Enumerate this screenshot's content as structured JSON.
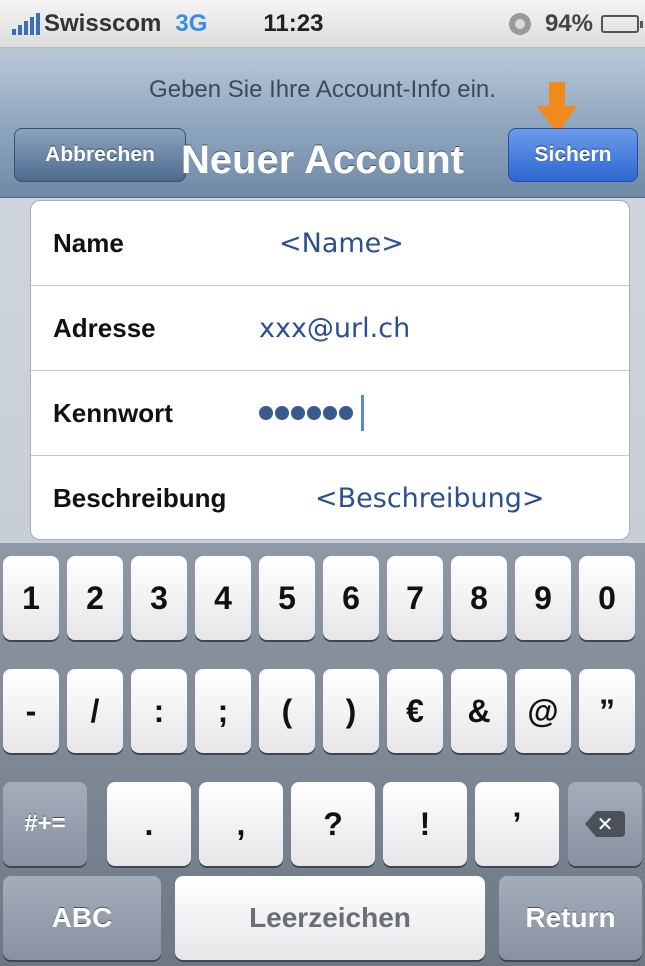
{
  "status_bar": {
    "carrier": "Swisscom",
    "network": "3G",
    "time": "11:23",
    "battery_percent": "94%",
    "battery_level": 0.94,
    "icons": [
      "signal-icon",
      "alarm-icon",
      "battery-icon"
    ]
  },
  "nav": {
    "prompt": "Geben Sie Ihre Account-Info ein.",
    "title": "Neuer Account",
    "cancel_label": "Abbrechen",
    "save_label": "Sichern",
    "annotation_color": "#f08a1c"
  },
  "form": {
    "fields": [
      {
        "label": "Name",
        "value": "<Name>"
      },
      {
        "label": "Adresse",
        "value": "xxx@url.ch"
      },
      {
        "label": "Kennwort",
        "masked_length": 6
      },
      {
        "label": "Beschreibung",
        "value": "<Beschreibung>"
      }
    ],
    "value_color": "#2b4f8f"
  },
  "keyboard": {
    "row1": [
      "1",
      "2",
      "3",
      "4",
      "5",
      "6",
      "7",
      "8",
      "9",
      "0"
    ],
    "row2": [
      "-",
      "/",
      ":",
      ";",
      "(",
      ")",
      "€",
      "&",
      "@",
      "”"
    ],
    "row3": [
      ".",
      ",",
      "?",
      "!",
      "’"
    ],
    "symbols_key": "#+=",
    "abc_key": "ABC",
    "space_key": "Leerzeichen",
    "return_key": "Return"
  }
}
